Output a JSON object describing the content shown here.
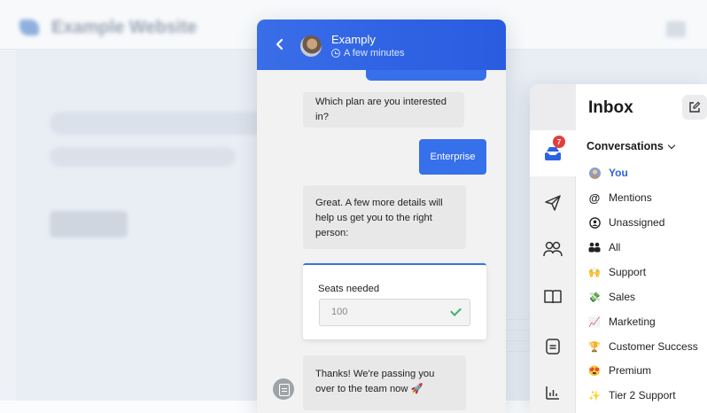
{
  "website": {
    "title": "Example Website"
  },
  "chat": {
    "header": {
      "agent_name": "Examply",
      "agent_status": "A few minutes",
      "back_icon": "chevron-left-icon",
      "status_icon": "clock-icon"
    },
    "messages": [
      {
        "from": "bot",
        "text": "Which plan are you interested in?"
      },
      {
        "from": "user",
        "text": "Enterprise"
      },
      {
        "from": "bot",
        "text": "Great. A few more details will help us get you to the right person:"
      },
      {
        "from": "bot",
        "text": "Thanks! We're passing you over to the team now 🚀"
      }
    ],
    "form": {
      "label": "Seats needed",
      "value": "100",
      "status_icon": "check-icon"
    },
    "colors": {
      "accent": "#3670ea",
      "bot_bubble": "#e8e8e8"
    }
  },
  "inbox": {
    "title": "Inbox",
    "compose_icon": "compose-icon",
    "rail": [
      {
        "icon": "inbox-icon",
        "badge": "7",
        "active": true
      },
      {
        "icon": "paper-plane-icon"
      },
      {
        "icon": "contacts-icon"
      },
      {
        "icon": "book-icon"
      },
      {
        "icon": "message-icon"
      },
      {
        "icon": "reports-icon"
      }
    ],
    "section_label": "Conversations",
    "items": [
      {
        "label": "You",
        "icon": "user-avatar-icon",
        "selected": true
      },
      {
        "label": "Mentions",
        "icon": "at-icon"
      },
      {
        "label": "Unassigned",
        "icon": "unassigned-icon"
      },
      {
        "label": "All",
        "icon": "group-icon"
      },
      {
        "label": "Support",
        "icon": "🙌"
      },
      {
        "label": "Sales",
        "icon": "💸"
      },
      {
        "label": "Marketing",
        "icon": "📈"
      },
      {
        "label": "Customer Success",
        "icon": "🏆"
      },
      {
        "label": "Premium",
        "icon": "😍"
      },
      {
        "label": "Tier 2 Support",
        "icon": "✨"
      }
    ],
    "colors": {
      "selected": "#2f62e3",
      "badge": "#e43d3d"
    }
  }
}
